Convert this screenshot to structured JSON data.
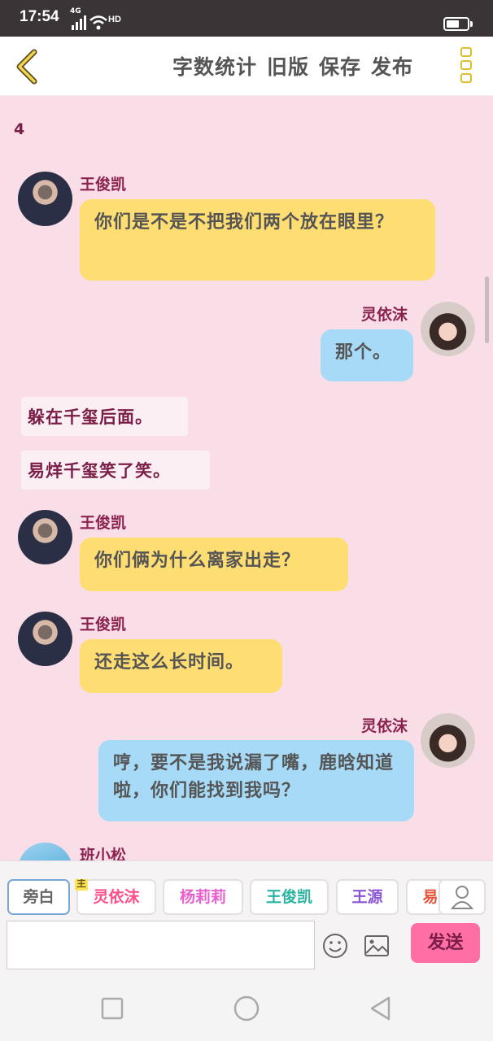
{
  "status_bar": {
    "time": "17:54",
    "network": "4G",
    "hd_label": "HD",
    "icons": [
      "signal-icon",
      "wifi-icon",
      "hd-icon",
      "battery-icon"
    ]
  },
  "toolbar": {
    "back_icon": "chevron-left-icon",
    "actions": [
      "字数统计",
      "旧版",
      "保存",
      "发布"
    ],
    "more_icon": "more-vertical-icon",
    "accent_color": "#e0bd2e"
  },
  "chat": {
    "chapter_number": "4",
    "messages": [
      {
        "type": "left",
        "name": "王俊凯",
        "text": "你们是不是不把我们两个放在眼里？",
        "avatar": "boy"
      },
      {
        "type": "right",
        "name": "灵依沫",
        "text": "那个。",
        "avatar": "girl"
      },
      {
        "type": "narration",
        "text": "躲在千玺后面。"
      },
      {
        "type": "narration",
        "text": "易烊千玺笑了笑。"
      },
      {
        "type": "left",
        "name": "王俊凯",
        "text": "你们俩为什么离家出走？",
        "avatar": "boy"
      },
      {
        "type": "left",
        "name": "王俊凯",
        "text": "还走这么长时间。",
        "avatar": "boy"
      },
      {
        "type": "right",
        "name": "灵依沫",
        "text": "哼，要不是我说漏了嘴，鹿晗知道啦，你们能找到我吗？",
        "avatar": "girl"
      },
      {
        "type": "left",
        "name": "班小松",
        "text": "",
        "avatar": "blue"
      }
    ]
  },
  "composer": {
    "characters": [
      {
        "label": "旁白",
        "color": "#666666",
        "selected": true
      },
      {
        "label": "灵依沫",
        "color": "#ff4f8a",
        "lead_badge": "主"
      },
      {
        "label": "杨莉莉",
        "color": "#e85fd0"
      },
      {
        "label": "王俊凯",
        "color": "#2bb3a3"
      },
      {
        "label": "王源",
        "color": "#8a56d6"
      },
      {
        "label": "易",
        "color": "#e5533a"
      }
    ],
    "user_icon": "user-icon",
    "input_value": "",
    "emoji_icon": "smiley-icon",
    "image_icon": "image-icon",
    "send_label": "发送",
    "send_color": "#ff6fa6"
  },
  "nav_bar": {
    "icons": [
      "recents-square-icon",
      "home-circle-icon",
      "back-triangle-icon"
    ]
  },
  "colors": {
    "background": "#f9dde7",
    "bubble_left": "#fedd73",
    "bubble_right": "#a6daf7",
    "name_color": "#8a2350"
  }
}
